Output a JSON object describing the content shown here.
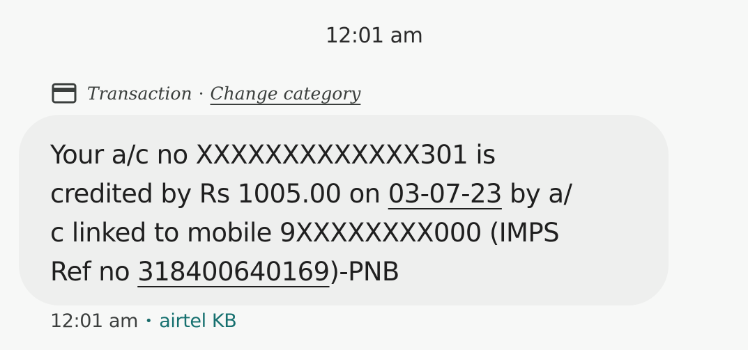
{
  "header": {
    "timestamp": "12:01 am"
  },
  "category": {
    "icon": "credit-card-icon",
    "label": "Transaction",
    "separator": "·",
    "change_link": "Change category"
  },
  "message": {
    "line1": "Your a/c no XXXXXXXXXXXXX301 is",
    "line2_pre": "credited by Rs 1005.00 on ",
    "date_link": "03-07-23",
    "line2_post": " by a/",
    "line3": "c linked to mobile 9XXXXXXXX000 (IMPS",
    "line4_pre": "Ref no ",
    "ref_link": "318400640169",
    "line4_post": ")-PNB"
  },
  "footer": {
    "time": "12:01 am",
    "dot": "•",
    "sender": "airtel KB"
  },
  "colors": {
    "background": "#f7f8f7",
    "bubble": "#eeefee",
    "sender_accent": "#16706f"
  }
}
